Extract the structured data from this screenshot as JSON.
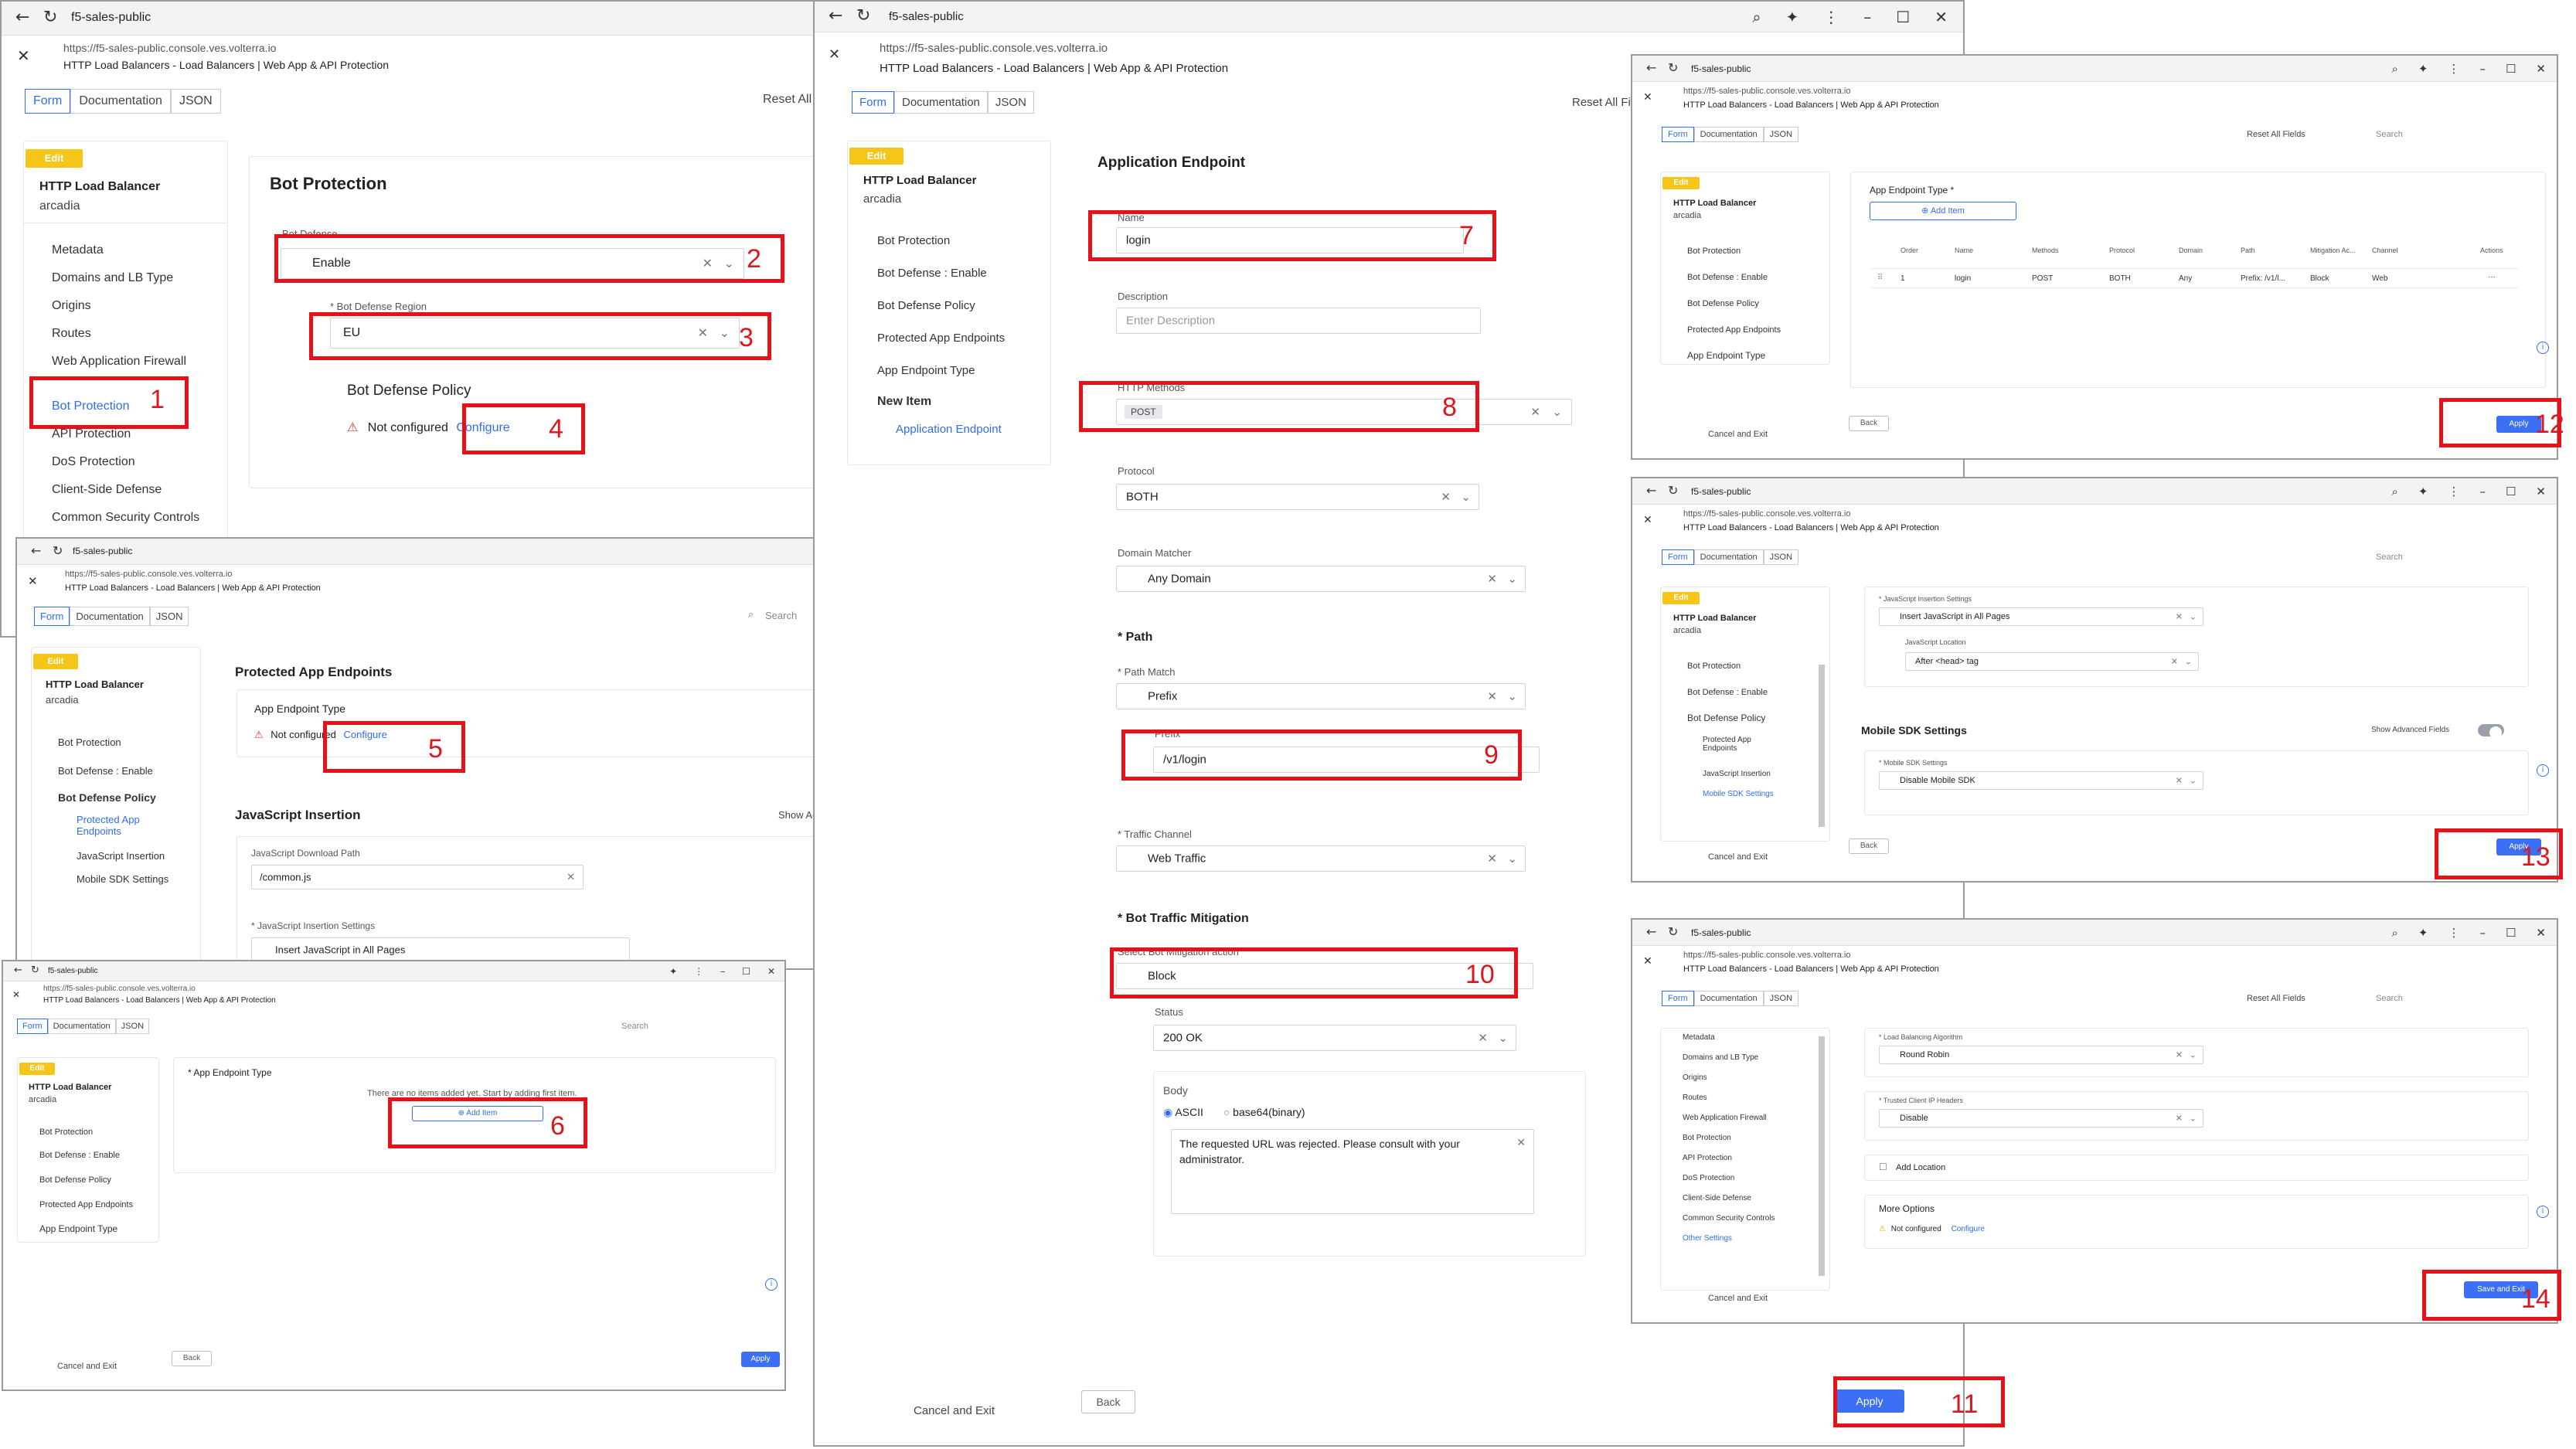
{
  "browser": {
    "tab_title": "f5-sales-public",
    "url": "https://f5-sales-public.console.ves.volterra.io",
    "subtitle": "HTTP Load Balancers - Load Balancers | Web App & API Protection"
  },
  "tabs": {
    "form": "Form",
    "documentation": "Documentation",
    "json": "JSON"
  },
  "header": {
    "edit": "Edit",
    "lb_title": "HTTP Load Balancer",
    "lb_name": "arcadia",
    "reset": "Reset All Fields",
    "search": "Search"
  },
  "buttons": {
    "cancel_exit": "Cancel and Exit",
    "back": "Back",
    "apply": "Apply",
    "save_exit": "Save and Exit",
    "add_item": "Add Item",
    "configure": "Configure"
  },
  "common": {
    "not_configured": "Not configured",
    "no_items": "There are no items added yet. Start by adding first item."
  },
  "win1": {
    "nav": [
      "Metadata",
      "Domains and LB Type",
      "Origins",
      "Routes",
      "Web Application Firewall",
      "Bot Protection",
      "API Protection",
      "DoS Protection",
      "Client-Side Defense",
      "Common Security Controls"
    ],
    "panel_title": "Bot Protection",
    "bot_defense_label": "Bot Defense",
    "bot_defense_value": "Enable",
    "region_label": "* Bot Defense Region",
    "region_value": "EU",
    "policy_label": "Bot Defense Policy"
  },
  "win2": {
    "nav": [
      "Bot Protection",
      "Bot Defense : Enable",
      "Bot Defense Policy",
      "Protected App Endpoints",
      "JavaScript Insertion",
      "Mobile SDK Settings"
    ],
    "panel_title": "Protected App Endpoints",
    "endpoint_label": "App Endpoint Type",
    "js_title": "JavaScript Insertion",
    "show_adv": "Show Ad",
    "js_path_label": "JavaScript Download Path",
    "js_path_value": "/common.js",
    "js_settings_label": "* JavaScript Insertion Settings",
    "js_settings_value": "Insert JavaScript in All Pages"
  },
  "win3": {
    "nav": [
      "Bot Protection",
      "Bot Defense : Enable",
      "Bot Defense Policy",
      "Protected App Endpoints",
      "App Endpoint Type"
    ],
    "endpoint_label": "* App Endpoint Type"
  },
  "win4": {
    "nav": [
      "Bot Protection",
      "Bot Defense : Enable",
      "Bot Defense Policy",
      "Protected App Endpoints",
      "App Endpoint Type",
      "New Item",
      "Application Endpoint"
    ],
    "panel_title": "Application Endpoint",
    "name_label": "Name",
    "name_value": "login",
    "desc_label": "Description",
    "desc_placeholder": "Enter Description",
    "methods_label": "HTTP Methods",
    "methods_value": "POST",
    "protocol_label": "Protocol",
    "protocol_value": "BOTH",
    "domain_label": "Domain Matcher",
    "domain_value": "Any Domain",
    "path_title": "* Path",
    "path_match_label": "* Path Match",
    "path_match_value": "Prefix",
    "prefix_label": "Prefix",
    "prefix_value": "/v1/login",
    "traffic_label": "* Traffic Channel",
    "traffic_value": "Web Traffic",
    "mitigation_title": "* Bot Traffic Mitigation",
    "mitigation_action_label": "Select Bot Mitigation action",
    "mitigation_value": "Block",
    "status_label": "Status",
    "status_value": "200 OK",
    "body_label": "Body",
    "ascii": "ASCII",
    "base64": "base64(binary)",
    "body_text": "The requested URL was rejected. Please consult with your administrator."
  },
  "win5": {
    "nav": [
      "Bot Protection",
      "Bot Defense : Enable",
      "Bot Defense Policy",
      "Protected App Endpoints",
      "App Endpoint Type"
    ],
    "endpoint_label": "App Endpoint Type *",
    "columns": [
      "Order",
      "Name",
      "Methods",
      "Protocol",
      "Domain",
      "Path",
      "Mitigation Ac...",
      "Channel",
      "Actions"
    ],
    "row": [
      "1",
      "login",
      "POST",
      "BOTH",
      "Any",
      "Prefix: /v1/l...",
      "Block",
      "Web",
      "···"
    ]
  },
  "win6": {
    "nav": [
      "Bot Protection",
      "Bot Defense : Enable",
      "Bot Defense Policy",
      "Protected App Endpoints",
      "JavaScript Insertion",
      "Mobile SDK Settings"
    ],
    "js_settings_label": "* JavaScript Insertion Settings",
    "js_settings_value": "Insert JavaScript in All Pages",
    "js_location_label": "JavaScript Location",
    "js_location_value": "After <head> tag",
    "mobile_title": "Mobile SDK Settings",
    "show_adv": "Show Advanced Fields",
    "mobile_label": "* Mobile SDK Settings",
    "mobile_value": "Disable Mobile SDK"
  },
  "win7": {
    "nav": [
      "Metadata",
      "Domains and LB Type",
      "Origins",
      "Routes",
      "Web Application Firewall",
      "Bot Protection",
      "API Protection",
      "DoS Protection",
      "Client-Side Defense",
      "Common Security Controls",
      "Other Settings"
    ],
    "lb_algo_label": "* Load Balancing Algorithm",
    "lb_algo_value": "Round Robin",
    "trusted_label": "* Trusted Client IP Headers",
    "trusted_value": "Disable",
    "add_location": "Add Location",
    "more_options": "More Options"
  },
  "markers": [
    "1",
    "2",
    "3",
    "4",
    "5",
    "6",
    "7",
    "8",
    "9",
    "10",
    "11",
    "12",
    "13",
    "14"
  ]
}
